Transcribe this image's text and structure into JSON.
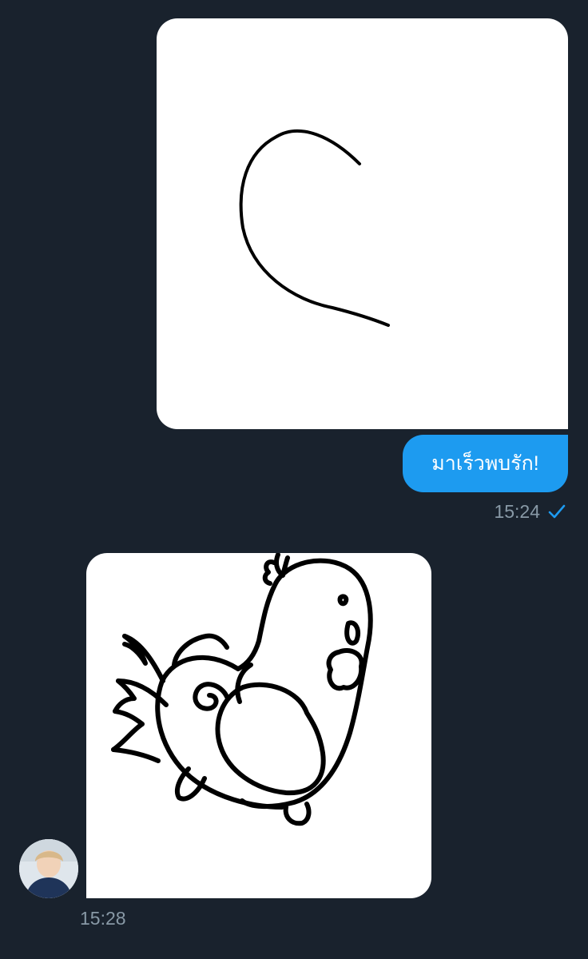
{
  "conversation": {
    "sent_message": {
      "text": "มาเร็วพบรัก!",
      "time": "15:24",
      "status_icon": "check-icon",
      "image": {
        "type": "drawing",
        "subject": "half-heart-icon"
      }
    },
    "received_message": {
      "time": "15:28",
      "image": {
        "type": "drawing",
        "subject": "rooster-icon"
      },
      "sender_avatar": "avatar"
    }
  },
  "colors": {
    "background": "#19222d",
    "bubble_sent": "#1d9bf0",
    "timestamp": "#8899a6",
    "check": "#1d9bf0"
  }
}
